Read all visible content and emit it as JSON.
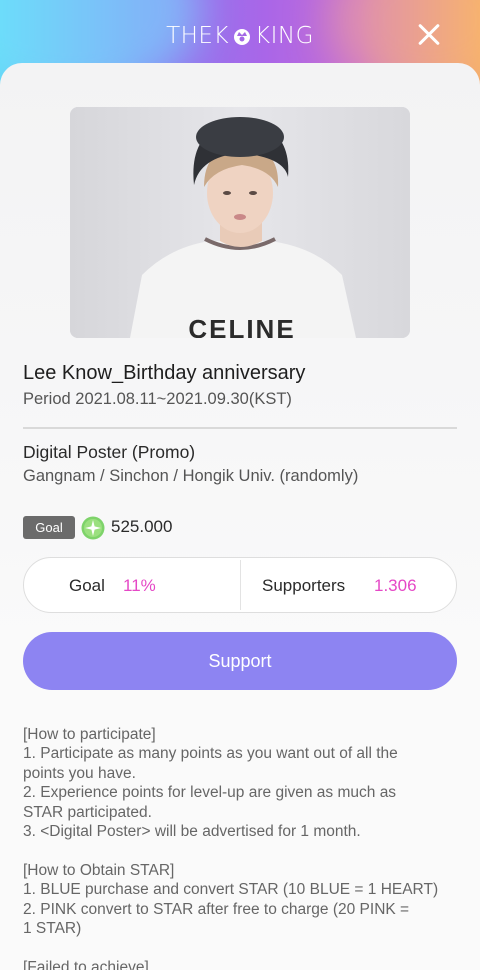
{
  "header": {
    "logo_left": "THEK",
    "logo_right": "KING",
    "colors": {
      "accent": "#8d84f2",
      "highlight": "#e548c6"
    }
  },
  "project": {
    "title": "Lee Know_Birthday anniversary",
    "period": "Period 2021.08.11~2021.09.30(KST)",
    "reward_title": "Digital Poster (Promo)",
    "reward_locations": "Gangnam / Sinchon / Hongik Univ. (randomly)",
    "photo_shirt_text": "CELINE"
  },
  "goal": {
    "badge": "Goal",
    "icon": "star-icon",
    "value": "525.000"
  },
  "stats": {
    "goal_label": "Goal",
    "goal_percent": "11%",
    "supporters_label": "Supporters",
    "supporters_count": "1.306"
  },
  "support_button": "Support",
  "notes": [
    "[How to participate]",
    "1. Participate as many points as you want out of all the",
    "points you have.",
    "2. Experience points for level-up are given as much as",
    "STAR participated.",
    "3. <Digital Poster> will be advertised for 1 month.",
    "",
    "[How to Obtain STAR]",
    "1. BLUE purchase and convert STAR (10 BLUE = 1 HEART)",
    "2. PINK convert to STAR after free to charge (20 PINK =",
    "1 STAR)",
    "",
    "[Failed to achieve]"
  ]
}
